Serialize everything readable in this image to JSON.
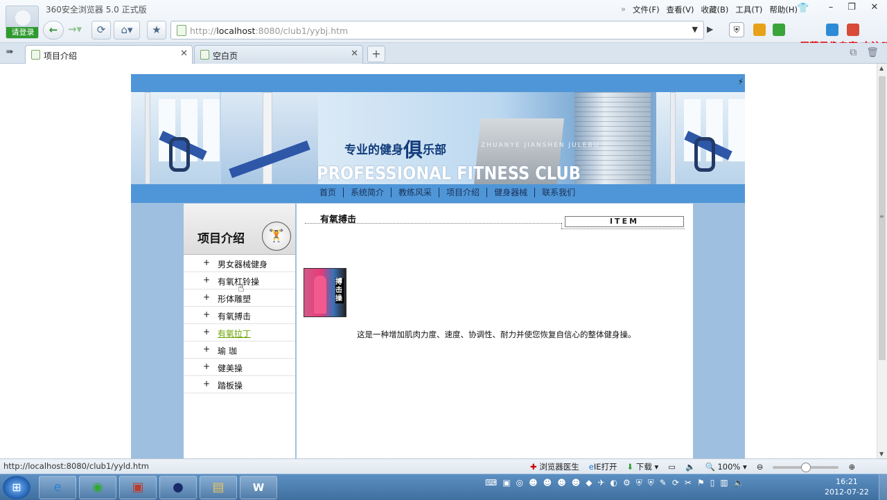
{
  "browser": {
    "title": "360安全浏览器 5.0 正式版",
    "login_label": "请登录",
    "menu": [
      "文件(F)",
      "查看(V)",
      "收藏(B)",
      "工具(T)",
      "帮助(H)"
    ],
    "address": {
      "prefix": "http://",
      "host": "localhost",
      "rest": ":8080/club1/yybj.htm"
    },
    "watermark": "屏幕录像专家 未注册",
    "tabs": [
      {
        "label": "项目介绍",
        "active": true
      },
      {
        "label": "空白页",
        "active": false
      }
    ]
  },
  "site": {
    "slogan_a": "专业的健身",
    "slogan_b": "俱",
    "slogan_c": "乐部",
    "pinyin": "ZHUANYE  JIANSHEN  JULEBU",
    "club_name": "PROFESSIONAL FITNESS CLUB",
    "nav": [
      "首页",
      "系统简介",
      "教练风采",
      "项目介绍",
      "健身器械",
      "联系我们"
    ],
    "left_title": "项目介绍",
    "menu": [
      {
        "label": "男女器械健身"
      },
      {
        "label": "有氧杠铃操"
      },
      {
        "label": "形体雕塑"
      },
      {
        "label": "有氧搏击"
      },
      {
        "label": "有氧拉丁"
      },
      {
        "label": "瑜  珈"
      },
      {
        "label": "健美操"
      },
      {
        "label": "踏板操"
      }
    ],
    "menu_plus": "+",
    "section_title": "有氧搏击",
    "item_label": "ITEM",
    "thumb_text": "搏击操",
    "description": "这是一种增加肌肉力度、速度、协调性、耐力并使您恢复自信心的整体健身操。"
  },
  "status": {
    "url": "http://localhost:8080/club1/yyld.htm",
    "doctor": "浏览器医生",
    "ie": "IE打开",
    "download": "下载",
    "zoom": "100%",
    "zoom_level": 0.5
  },
  "taskbar": {
    "time": "16:21",
    "date": "2012-07-22"
  }
}
